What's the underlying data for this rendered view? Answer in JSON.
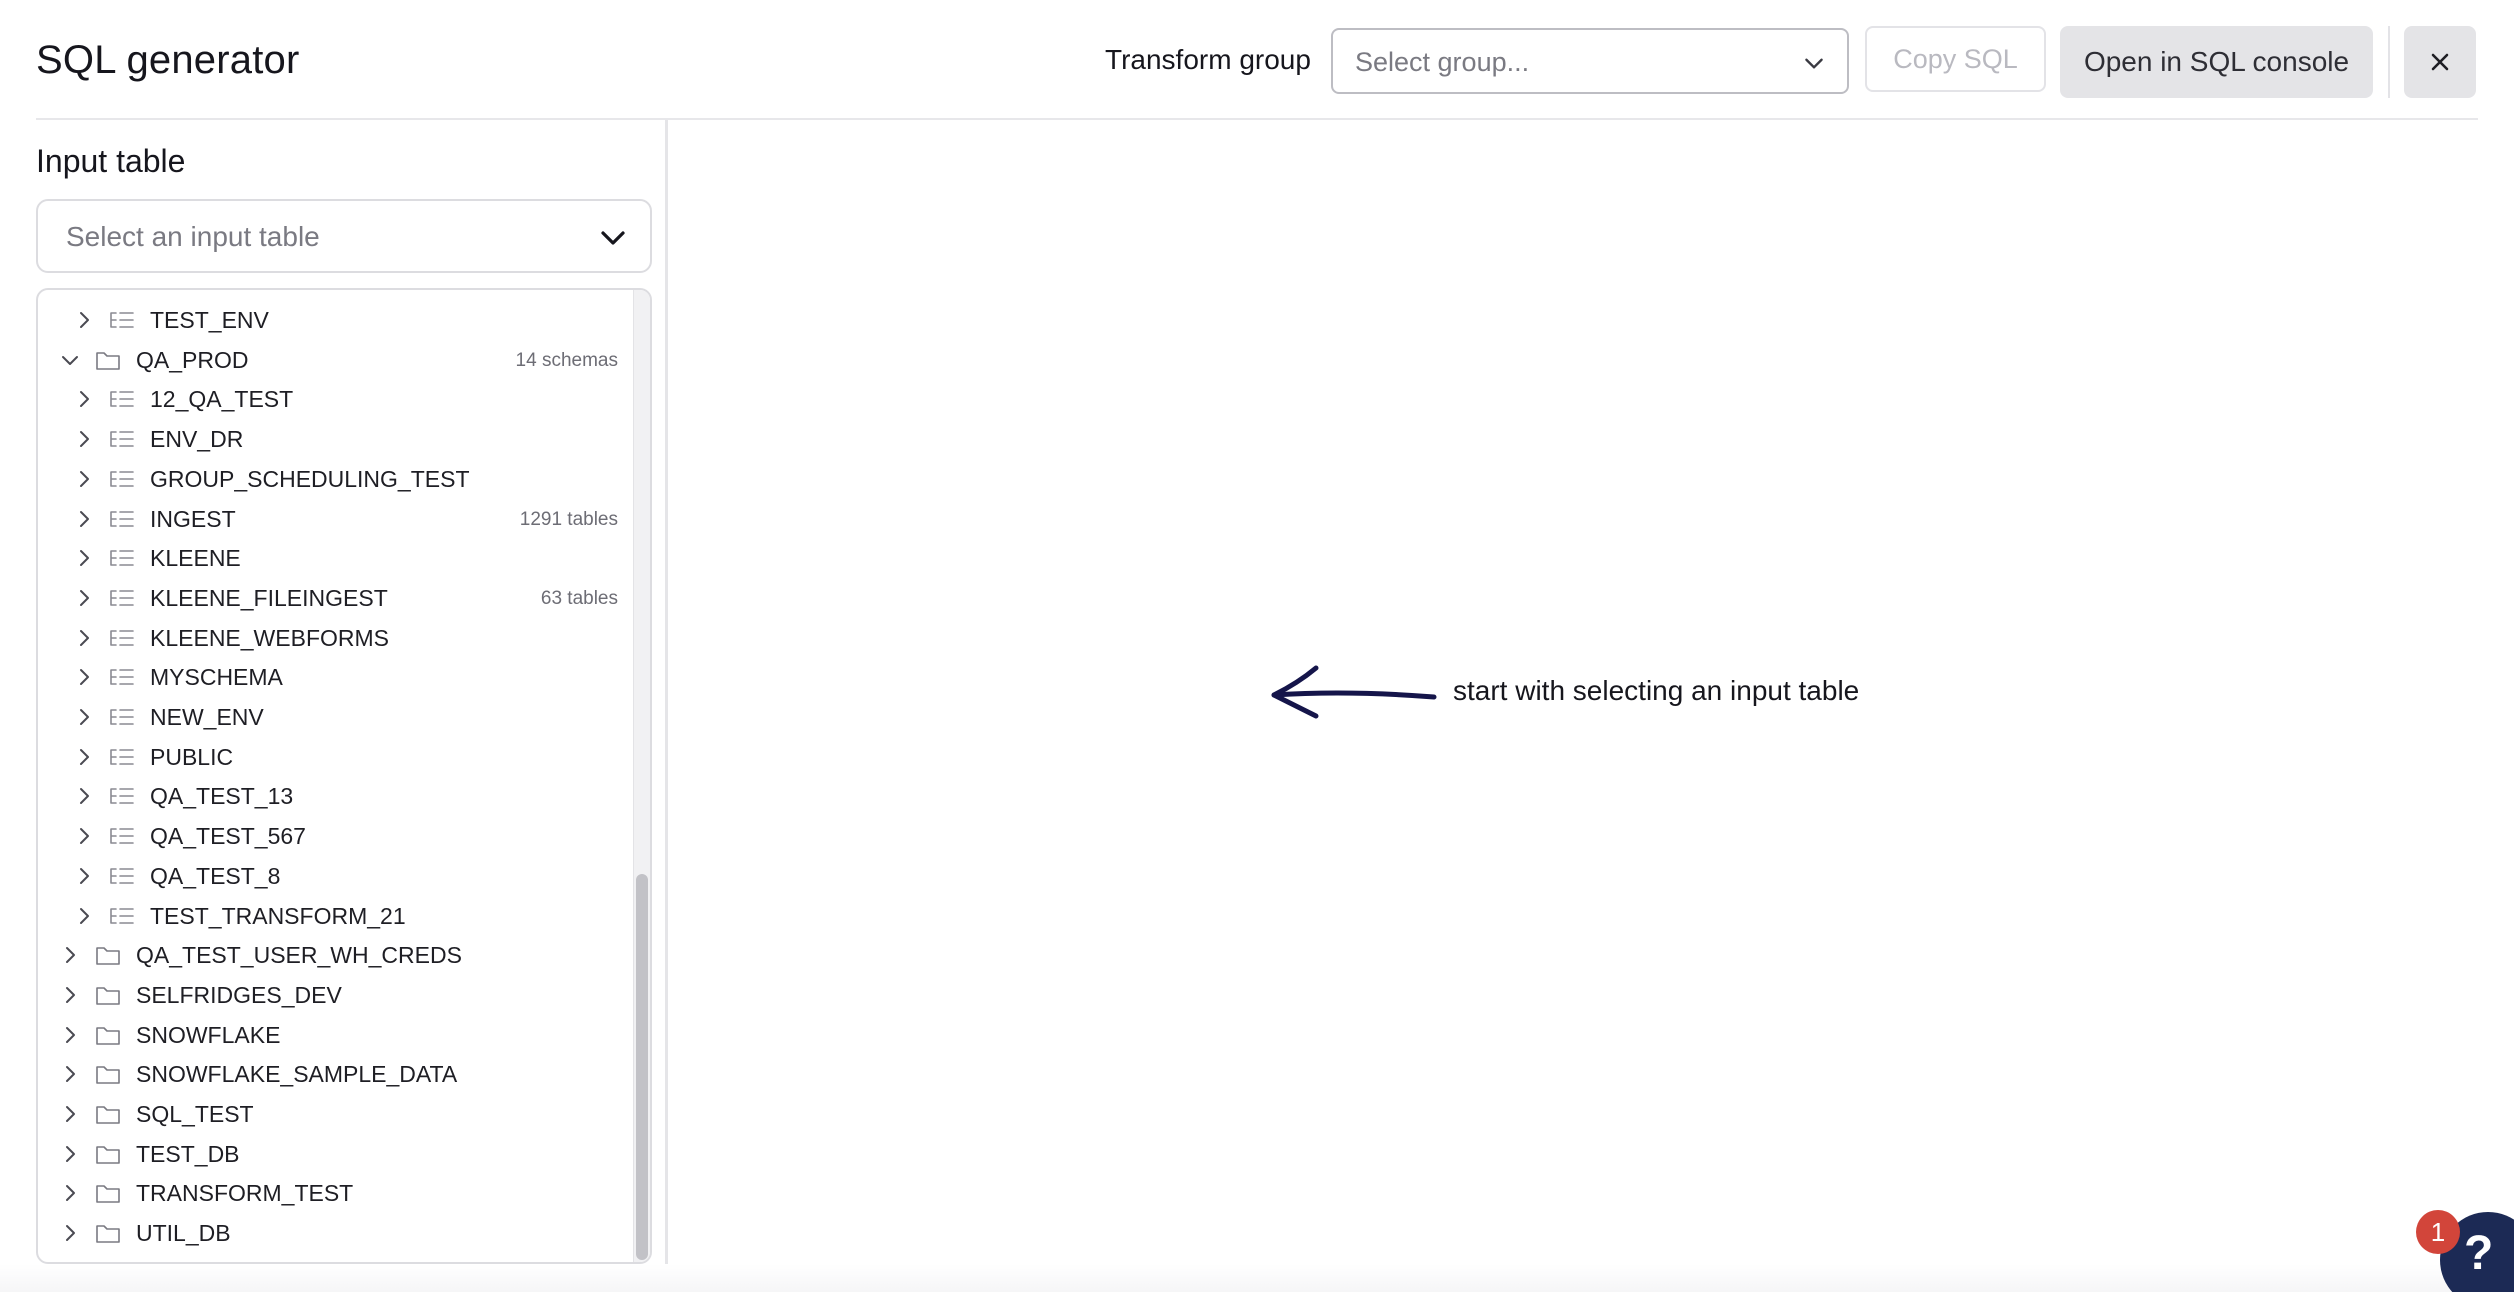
{
  "header": {
    "title": "SQL generator",
    "transform_group_label": "Transform group",
    "group_select_placeholder": "Select group...",
    "copy_sql_label": "Copy SQL",
    "open_console_label": "Open in SQL console",
    "close_icon": "close-icon"
  },
  "sidebar": {
    "section_title": "Input table",
    "table_select_placeholder": "Select an input table",
    "tree": [
      {
        "kind": "schema",
        "label": "TEST_ENV",
        "expanded": false,
        "count": ""
      },
      {
        "kind": "db",
        "label": "QA_PROD",
        "expanded": true,
        "count": "14 schemas"
      },
      {
        "kind": "schema",
        "label": "12_QA_TEST",
        "expanded": false,
        "count": ""
      },
      {
        "kind": "schema",
        "label": "ENV_DR",
        "expanded": false,
        "count": ""
      },
      {
        "kind": "schema",
        "label": "GROUP_SCHEDULING_TEST",
        "expanded": false,
        "count": ""
      },
      {
        "kind": "schema",
        "label": "INGEST",
        "expanded": false,
        "count": "1291 tables"
      },
      {
        "kind": "schema",
        "label": "KLEENE",
        "expanded": false,
        "count": ""
      },
      {
        "kind": "schema",
        "label": "KLEENE_FILEINGEST",
        "expanded": false,
        "count": "63 tables"
      },
      {
        "kind": "schema",
        "label": "KLEENE_WEBFORMS",
        "expanded": false,
        "count": ""
      },
      {
        "kind": "schema",
        "label": "MYSCHEMA",
        "expanded": false,
        "count": ""
      },
      {
        "kind": "schema",
        "label": "NEW_ENV",
        "expanded": false,
        "count": ""
      },
      {
        "kind": "schema",
        "label": "PUBLIC",
        "expanded": false,
        "count": ""
      },
      {
        "kind": "schema",
        "label": "QA_TEST_13",
        "expanded": false,
        "count": ""
      },
      {
        "kind": "schema",
        "label": "QA_TEST_567",
        "expanded": false,
        "count": ""
      },
      {
        "kind": "schema",
        "label": "QA_TEST_8",
        "expanded": false,
        "count": ""
      },
      {
        "kind": "schema",
        "label": "TEST_TRANSFORM_21",
        "expanded": false,
        "count": ""
      },
      {
        "kind": "db",
        "label": "QA_TEST_USER_WH_CREDS",
        "expanded": false,
        "count": ""
      },
      {
        "kind": "db",
        "label": "SELFRIDGES_DEV",
        "expanded": false,
        "count": ""
      },
      {
        "kind": "db",
        "label": "SNOWFLAKE",
        "expanded": false,
        "count": ""
      },
      {
        "kind": "db",
        "label": "SNOWFLAKE_SAMPLE_DATA",
        "expanded": false,
        "count": ""
      },
      {
        "kind": "db",
        "label": "SQL_TEST",
        "expanded": false,
        "count": ""
      },
      {
        "kind": "db",
        "label": "TEST_DB",
        "expanded": false,
        "count": ""
      },
      {
        "kind": "db",
        "label": "TRANSFORM_TEST",
        "expanded": false,
        "count": ""
      },
      {
        "kind": "db",
        "label": "UTIL_DB",
        "expanded": false,
        "count": ""
      }
    ]
  },
  "main": {
    "hint_text": "start with selecting an input table",
    "hint_icon": "arrow-left-hand-drawn-icon"
  },
  "help": {
    "badge_count": "1",
    "glyph": "?",
    "icon": "help-icon"
  },
  "colors": {
    "arrow": "#15154a",
    "help_bg": "#1c2a55",
    "badge": "#d2453a",
    "button_bg": "#e4e4e7"
  }
}
